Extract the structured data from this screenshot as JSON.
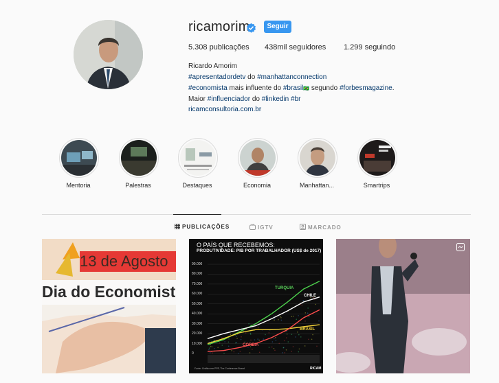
{
  "profile": {
    "username": "ricamorim",
    "follow_label": "Seguir",
    "stats": {
      "posts": "5.308 publicações",
      "followers": "438mil seguidores",
      "following": "1.299 seguindo"
    },
    "full_name": "Ricardo Amorim",
    "bio": {
      "l1_a": "#apresentadordetv",
      "l1_b": " do ",
      "l1_c": "#manhattanconnection",
      "l2_a": "#economista",
      "l2_b": " mais influente do ",
      "l2_c": "#brasil",
      "l2_d": "🇧🇷",
      "l2_e": " segundo ",
      "l2_f": "#forbesmagazine",
      "l2_g": ".",
      "l3_a": "Maior ",
      "l3_b": "#influenciador",
      "l3_c": " do ",
      "l3_d": "#linkedin",
      "l3_e": " ",
      "l3_f": "#br",
      "link": "ricamconsultoria.com.br"
    }
  },
  "highlights": [
    {
      "label": "Mentoria"
    },
    {
      "label": "Palestras"
    },
    {
      "label": "Destaques"
    },
    {
      "label": "Economia"
    },
    {
      "label": "Manhattan..."
    },
    {
      "label": "Smartrips"
    }
  ],
  "tabs": [
    {
      "label": "PUBLICAÇÕES",
      "icon": "grid-icon"
    },
    {
      "label": "IGTV",
      "icon": "igtv-icon"
    },
    {
      "label": "MARCADO",
      "icon": "tagged-icon"
    }
  ],
  "posts": {
    "p1": {
      "line1": "13 de Agosto",
      "line2": "Dia do Economista"
    },
    "p2": {
      "title1": "O PAÍS QUE RECEBEMOS:",
      "title2": "PRODUTIVIDADE: PIB POR TRABALHADOR (US$ de 2017)",
      "y_ticks": [
        "90.000",
        "80.000",
        "70.000",
        "60.000",
        "50.000",
        "40.000",
        "30.000",
        "20.000",
        "10.000",
        "0"
      ],
      "labels": {
        "turquia": "TURQUIA",
        "chile": "CHILE",
        "brasil": "BRASIL",
        "coreia": "COREIA"
      },
      "footer": "Fonte: Gráfico em PPP, The Conference Board",
      "brand": "RICAM"
    }
  },
  "chart_data": {
    "type": "line",
    "title": "PRODUTIVIDADE: PIB POR TRABALHADOR (US$ de 2017)",
    "ylim": [
      0,
      90000
    ],
    "series": [
      {
        "name": "TURQUIA",
        "values": [
          9000,
          14000,
          22000,
          30000,
          40000,
          52000,
          65000,
          73000
        ]
      },
      {
        "name": "CHILE",
        "values": [
          15000,
          20000,
          24000,
          28000,
          35000,
          43000,
          52000,
          57000
        ]
      },
      {
        "name": "BRASIL",
        "values": [
          10000,
          15000,
          21000,
          24000,
          24000,
          25000,
          27000,
          29000
        ]
      },
      {
        "name": "COREIA",
        "values": [
          2000,
          3000,
          6000,
          10000,
          16000,
          24000,
          36000,
          44000
        ]
      }
    ]
  }
}
